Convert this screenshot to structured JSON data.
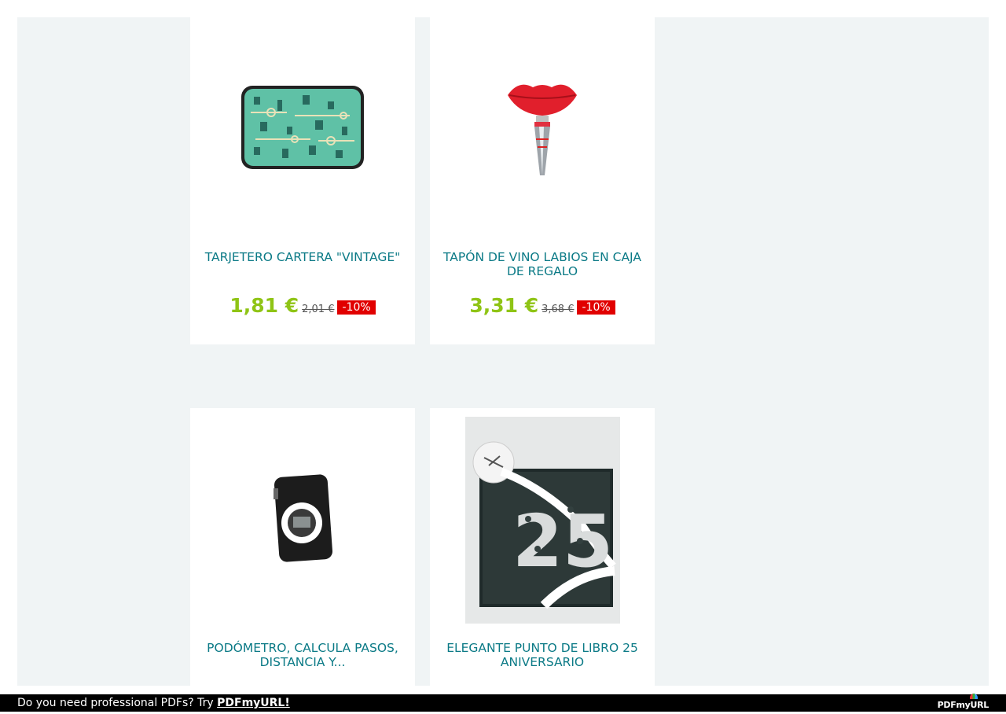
{
  "products": [
    {
      "name": "TARJETERO CARTERA \"VINTAGE\"",
      "price": "1,81 €",
      "old_price": "2,01 €",
      "discount": "-10%"
    },
    {
      "name": "TAPÓN DE VINO LABIOS EN CAJA DE REGALO",
      "price": "3,31 €",
      "old_price": "3,68 €",
      "discount": "-10%"
    },
    {
      "name": "PODÓMETRO, CALCULA PASOS, DISTANCIA Y...",
      "price": "",
      "old_price": "",
      "discount": ""
    },
    {
      "name": "ELEGANTE PUNTO DE LIBRO 25 ANIVERSARIO",
      "price": "",
      "old_price": "",
      "discount": ""
    }
  ],
  "footer": {
    "message": "Do you need professional PDFs? Try",
    "link_label": "PDFmyURL!",
    "logo_text": "PDFmyURL"
  },
  "colors": {
    "price": "#8fc415",
    "name": "#0b7a86",
    "discount_bg": "#e10000",
    "page_bg": "#f0f4f5"
  },
  "icons": [
    "card-wallet-image",
    "lips-wine-stopper-image",
    "pedometer-image",
    "bookmark-25-image"
  ]
}
